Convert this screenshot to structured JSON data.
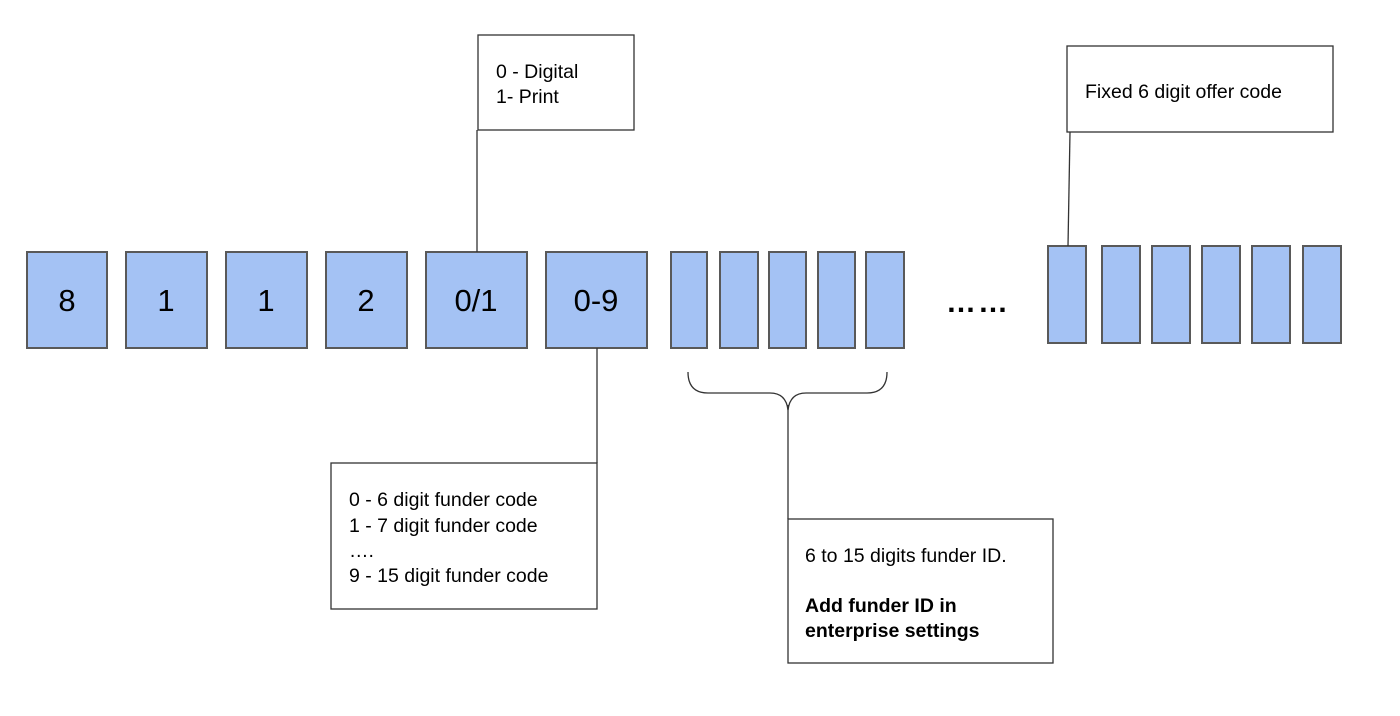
{
  "colors": {
    "cell_fill": "#a4c2f4",
    "cell_border": "#595959"
  },
  "digits": [
    "8",
    "1",
    "1",
    "2",
    "0/1",
    "0-9"
  ],
  "ellipsis": "……",
  "callouts": {
    "type": {
      "lines": [
        "0 - Digital",
        "1- Print"
      ]
    },
    "offer": {
      "lines": [
        "Fixed 6 digit offer code"
      ]
    },
    "length": {
      "lines": [
        "0 - 6 digit funder code",
        "1 - 7 digit funder code",
        "….",
        "9 - 15 digit funder code"
      ]
    },
    "funder": {
      "line": "6 to 15 digits funder ID.",
      "bold_lines": [
        "Add funder ID in",
        "enterprise settings"
      ]
    }
  }
}
